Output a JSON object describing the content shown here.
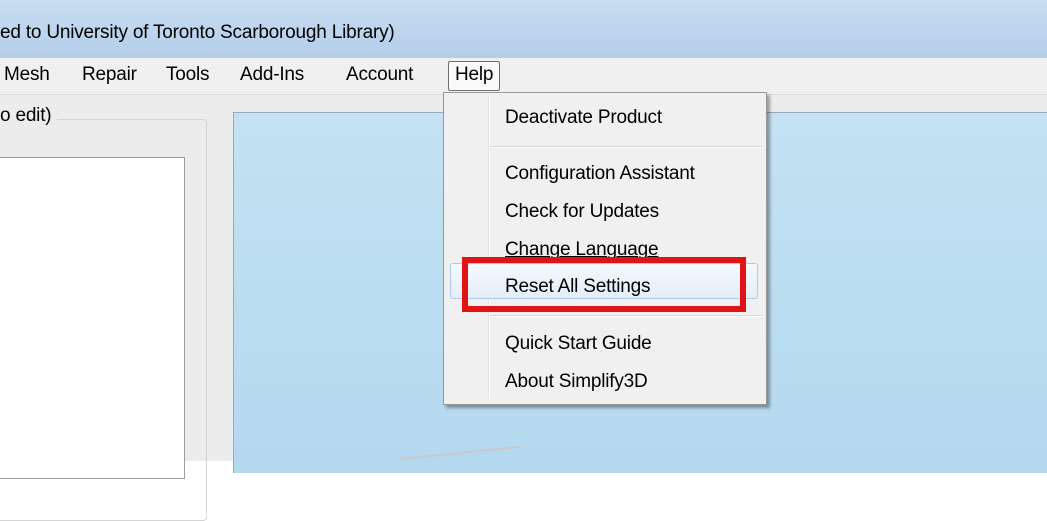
{
  "window": {
    "title": "ed to University of Toronto Scarborough Library)"
  },
  "menu": {
    "items": [
      "Mesh",
      "Repair",
      "Tools",
      "Add-Ins",
      "Account",
      "Help"
    ]
  },
  "left_panel": {
    "group_label": "o edit)"
  },
  "help_menu": {
    "items": [
      "Deactivate Product",
      "Configuration Assistant",
      "Check for Updates",
      "Change Language",
      "Reset All Settings",
      "Quick Start Guide",
      "About Simplify3D"
    ],
    "hovered_item": "Reset All Settings"
  },
  "annotation": {
    "highlight_color": "#e01414",
    "highlighted_item": "Reset All Settings"
  },
  "colors": {
    "title_bar": "#bdd5ee",
    "menu_bar": "#f0f0f0",
    "viewport": "#b9dcf0"
  }
}
